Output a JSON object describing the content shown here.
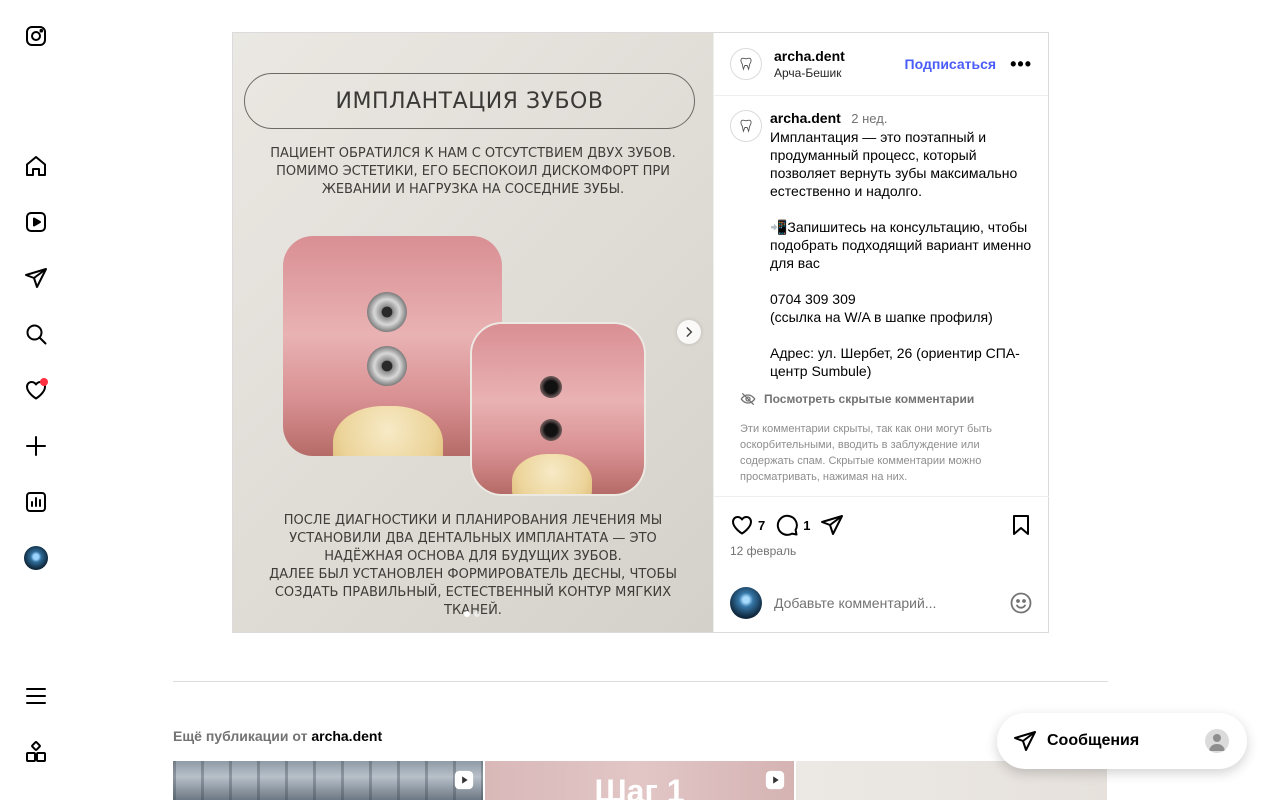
{
  "nav": {
    "items": [
      {
        "name": "instagram-logo-icon"
      },
      {
        "name": "home-icon"
      },
      {
        "name": "reels-icon"
      },
      {
        "name": "direct-icon"
      },
      {
        "name": "search-icon"
      },
      {
        "name": "notifications-icon"
      },
      {
        "name": "create-icon"
      },
      {
        "name": "dashboard-icon"
      },
      {
        "name": "profile-avatar"
      },
      {
        "name": "menu-icon"
      },
      {
        "name": "more-apps-icon"
      }
    ],
    "notification_color": "#ff3040"
  },
  "post": {
    "media": {
      "title": "ИМПЛАНТАЦИЯ ЗУБОВ",
      "text_top": "ПАЦИЕНТ ОБРАТИЛСЯ К НАМ С ОТСУТСТВИЕМ ДВУХ ЗУБОВ.\nПОМИМО ЭСТЕТИКИ, ЕГО БЕСПОКОИЛ ДИСКОМФОРТ ПРИ\nЖЕВАНИИ И НАГРУЗКА НА СОСЕДНИЕ ЗУБЫ.",
      "text_bottom": "ПОСЛЕ ДИАГНОСТИКИ И ПЛАНИРОВАНИЯ ЛЕЧЕНИЯ МЫ\nУСТАНОВИЛИ ДВА ДЕНТАЛЬНЫХ ИМПЛАНТАТА — ЭТО\nНАДЁЖНАЯ ОСНОВА ДЛЯ БУДУЩИХ ЗУБОВ.\nДАЛЕЕ БЫЛ УСТАНОВЛЕН ФОРМИРОВАТЕЛЬ ДЕСНЫ, ЧТОБЫ\nСОЗДАТЬ ПРАВИЛЬНЫЙ, ЕСТЕСТВЕННЫЙ КОНТУР МЯГКИХ ТКАНЕЙ.",
      "slides": 2,
      "active_slide": 1
    },
    "header": {
      "username": "archa.dent",
      "location": "Арча-Бешик",
      "follow_label": "Подписаться",
      "more_label": "•••"
    },
    "caption": {
      "username": "archa.dent",
      "time": "2 нед.",
      "text": "Имплантация — это поэтапный и продуманный процесс, который позволяет вернуть зубы максимально естественно и надолго.\n\n📲Запишитесь на консультацию, чтобы подобрать подходящий вариант именно для вас\n\n0704 309 309\n(ссылка на W/A в шапке профиля)\n\nАдрес: ул. Шербет, 26 (ориентир СПА-центр Sumbule)"
    },
    "hidden_comments": {
      "link_label": "Посмотреть скрытые комментарии",
      "note": "Эти комментарии скрыты, так как они могут быть оскорбительными, вводить в заблуждение или содержать спам. Скрытые комментарии можно просматривать, нажимая на них."
    },
    "actions": {
      "likes": "7",
      "comments": "1",
      "date": "12 февраль"
    },
    "comment_box": {
      "placeholder": "Добавьте комментарий..."
    }
  },
  "more_posts": {
    "prefix": "Ещё публикации от",
    "username": "archa.dent",
    "thumbs": [
      {
        "text": ""
      },
      {
        "text": "Шаг 1"
      },
      {
        "text": ""
      }
    ]
  },
  "messages": {
    "label": "Сообщения"
  }
}
